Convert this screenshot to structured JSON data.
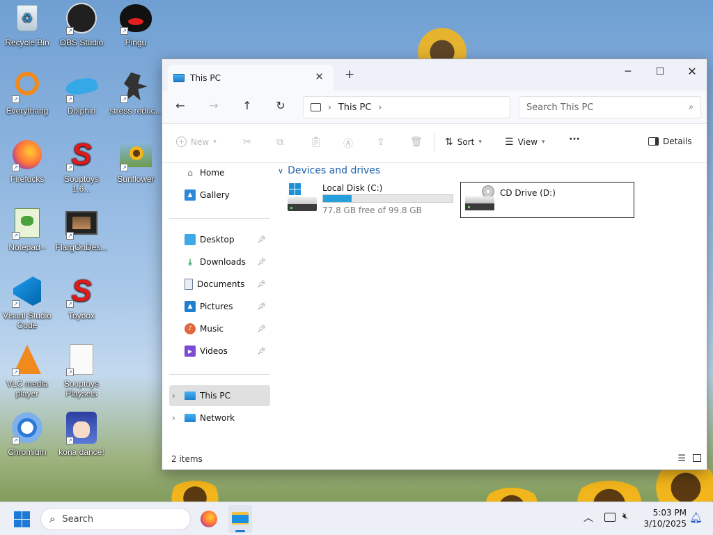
{
  "desktop": {
    "icons": [
      {
        "label": "Recycle Bin",
        "icon": "recycle-bin-icon"
      },
      {
        "label": "OBS Studio",
        "icon": "obs-icon"
      },
      {
        "label": "Pingu",
        "icon": "pingu-icon"
      },
      {
        "label": "Everythang",
        "icon": "everything-icon"
      },
      {
        "label": "Dolphin",
        "icon": "dolphin-icon"
      },
      {
        "label": "stress reduc...",
        "icon": "stress-icon"
      },
      {
        "label": "Firefucks",
        "icon": "firefox-icon"
      },
      {
        "label": "Souptoys 1.6...",
        "icon": "souptoys-icon"
      },
      {
        "label": "Sunflower",
        "icon": "sunflower-icon"
      },
      {
        "label": "Notepad--",
        "icon": "notepad-icon"
      },
      {
        "label": "FlargOnDes...",
        "icon": "flarg-icon"
      },
      {
        "label": "Visual Studio Code",
        "icon": "vscode-icon"
      },
      {
        "label": "Toybox",
        "icon": "toybox-icon"
      },
      {
        "label": "VLC media player",
        "icon": "vlc-icon"
      },
      {
        "label": "Souptoys Playsets",
        "icon": "file-icon"
      },
      {
        "label": "Chromium",
        "icon": "chromium-icon"
      },
      {
        "label": "kona dance!",
        "icon": "kona-icon"
      }
    ]
  },
  "window": {
    "tab_title": "This PC",
    "address": {
      "crumbs": [
        "This PC"
      ]
    },
    "search_placeholder": "Search This PC",
    "commands": {
      "new": "New",
      "sort": "Sort",
      "view": "View",
      "more": "···",
      "details": "Details"
    },
    "sidebar": {
      "quick": [
        {
          "label": "Home",
          "icon": "home-icon"
        },
        {
          "label": "Gallery",
          "icon": "gallery-icon"
        }
      ],
      "pinned": [
        {
          "label": "Desktop",
          "icon": "desktop-folder-icon"
        },
        {
          "label": "Downloads",
          "icon": "downloads-icon"
        },
        {
          "label": "Documents",
          "icon": "documents-icon"
        },
        {
          "label": "Pictures",
          "icon": "pictures-icon"
        },
        {
          "label": "Music",
          "icon": "music-icon"
        },
        {
          "label": "Videos",
          "icon": "videos-icon"
        }
      ],
      "tree": [
        {
          "label": "This PC",
          "icon": "this-pc-icon",
          "selected": true
        },
        {
          "label": "Network",
          "icon": "network-icon"
        }
      ]
    },
    "section_title": "Devices and drives",
    "drives": [
      {
        "name": "Local Disk (C:)",
        "free_text": "77.8 GB free of 99.8 GB",
        "used_fraction": 0.22
      },
      {
        "name": "CD Drive (D:)"
      }
    ],
    "status": "2 items"
  },
  "taskbar": {
    "search_label": "Search",
    "time": "5:03 PM",
    "date": "3/10/2025"
  },
  "colors": {
    "accent": "#1e90d6",
    "selected_bg": "#e0e0e0",
    "titlebar": "#eef2f8"
  }
}
